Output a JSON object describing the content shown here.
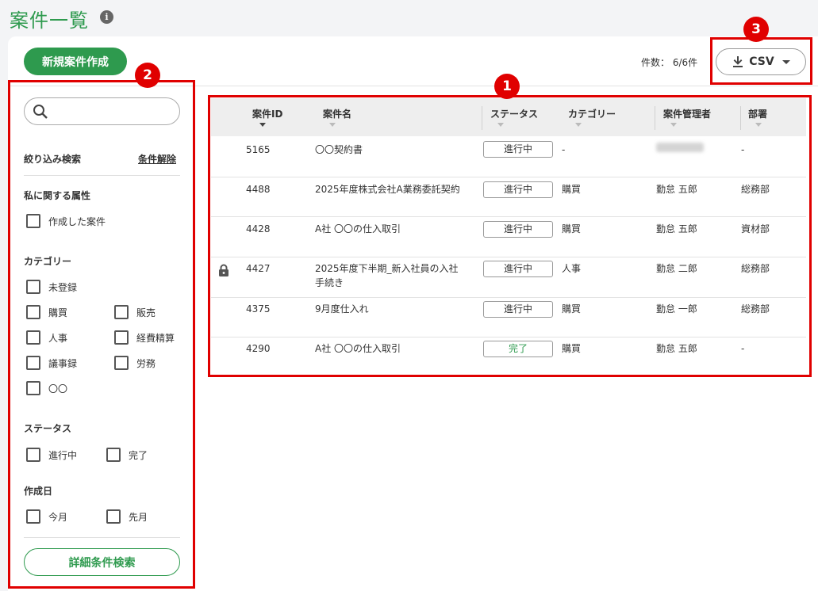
{
  "page": {
    "title": "案件一覧",
    "info_icon": "i"
  },
  "toolbar": {
    "new_button": "新規案件作成",
    "count_label": "件数：",
    "count_value": "6/6件",
    "csv_button": "CSV"
  },
  "sidebar": {
    "search_placeholder": "",
    "filter_heading": "絞り込み検索",
    "clear_link": "条件解除",
    "section_mine": "私に関する属性",
    "mine_items": [
      "作成した案件"
    ],
    "section_category": "カテゴリー",
    "category_items": [
      "未登録",
      "購買",
      "販売",
      "人事",
      "経費精算",
      "議事録",
      "労務",
      "〇〇"
    ],
    "section_status": "ステータス",
    "status_items": [
      "進行中",
      "完了"
    ],
    "section_created": "作成日",
    "created_items": [
      "今月",
      "先月"
    ],
    "detail_button": "詳細条件検索"
  },
  "table": {
    "columns": [
      "案件ID",
      "案件名",
      "ステータス",
      "カテゴリー",
      "案件管理者",
      "部署"
    ],
    "rows": [
      {
        "locked": false,
        "id": "5165",
        "name": "〇〇契約書",
        "name2": "",
        "status": "進行中",
        "category": "-",
        "manager": "",
        "dept": "-"
      },
      {
        "locked": false,
        "id": "4488",
        "name": "2025年度株式会社A業務委託契約",
        "name2": "",
        "status": "進行中",
        "category": "購買",
        "manager": "勤怠 五郎",
        "dept": "総務部"
      },
      {
        "locked": false,
        "id": "4428",
        "name": "A社 〇〇の仕入取引",
        "name2": "",
        "status": "進行中",
        "category": "購買",
        "manager": "勤怠 五郎",
        "dept": "資材部"
      },
      {
        "locked": true,
        "id": "4427",
        "name": "2025年度下半期_新入社員の入社",
        "name2": "手続き",
        "status": "進行中",
        "category": "人事",
        "manager": "勤怠 二郎",
        "dept": "総務部"
      },
      {
        "locked": false,
        "id": "4375",
        "name": "9月度仕入れ",
        "name2": "",
        "status": "進行中",
        "category": "購買",
        "manager": "勤怠 一郎",
        "dept": "総務部"
      },
      {
        "locked": false,
        "id": "4290",
        "name": "A社 〇〇の仕入取引",
        "name2": "",
        "status": "完了",
        "category": "購買",
        "manager": "勤怠 五郎",
        "dept": "-"
      }
    ]
  },
  "annotations": {
    "m1": "1",
    "m2": "2",
    "m3": "3"
  },
  "colors": {
    "brand": "#2e9a4e",
    "annotation": "#e00000"
  }
}
